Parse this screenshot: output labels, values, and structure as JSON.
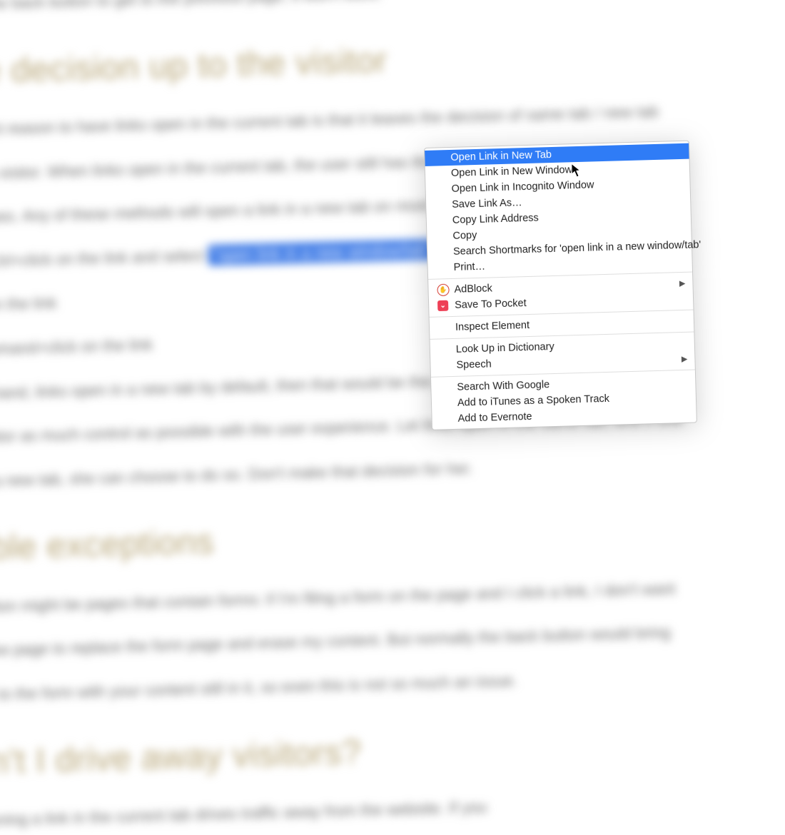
{
  "article": {
    "line_top": "click the back button to get to the previous page, it won't work.",
    "heading1": "the decision up to the visitor",
    "para1a": "portant reason to have links open in the current tab is that it leaves the decision of same tab / new tab",
    "para1b": "of the visitor. When links open in the current tab, the user still has the option of opening them in a new",
    "para1c": "chooses. Any of these methods will open a link in a new tab on most browsers:",
    "bullet1_pre": "k or Ctrl+click on the link and select ",
    "bullet1_hl": "\"open link in a new window/tab\"",
    "bullet2": "lick on the link",
    "bullet3": ", command+click on the link",
    "para2a": "ther hand, links open in a new tab by default, then that would be the page behavior regardless of what",
    "para2b": "e visitor as much control as possible with the user experience. Let links open in the same tab, and if she",
    "para2c": "n in a new tab, she can choose to do so. Don't make that decision for her.",
    "heading2": "sible exceptions",
    "para3a": "ception might be pages that contain forms: if I'm filing a form on the page and I click a link, I don't want",
    "para3b": "e new page to replace the form page and erase my content. But normally the back button would bring",
    "para3c": "you to the form with your content still in it, so even this is not so much an issue.",
    "heading3": "on't I drive away visitors?",
    "para4a": "opening a link in the current tab drives traffic away from the website. If you"
  },
  "menu": {
    "groups": [
      {
        "items": [
          {
            "label": "Open Link in New Tab",
            "selected": true
          },
          {
            "label": "Open Link in New Window"
          },
          {
            "label": "Open Link in Incognito Window"
          },
          {
            "label": "Save Link As…"
          },
          {
            "label": "Copy Link Address"
          },
          {
            "label": "Copy"
          },
          {
            "label": "Search Shortmarks for 'open link in a new window/tab'"
          },
          {
            "label": "Print…"
          }
        ]
      },
      {
        "items": [
          {
            "label": "AdBlock",
            "icon": "adblock",
            "submenu": true
          },
          {
            "label": "Save To Pocket",
            "icon": "pocket"
          }
        ]
      },
      {
        "items": [
          {
            "label": "Inspect Element"
          }
        ]
      },
      {
        "items": [
          {
            "label": "Look Up in Dictionary"
          },
          {
            "label": "Speech",
            "submenu": true
          }
        ]
      },
      {
        "items": [
          {
            "label": "Search With Google"
          },
          {
            "label": "Add to iTunes as a Spoken Track"
          },
          {
            "label": "Add to Evernote"
          }
        ]
      }
    ]
  }
}
